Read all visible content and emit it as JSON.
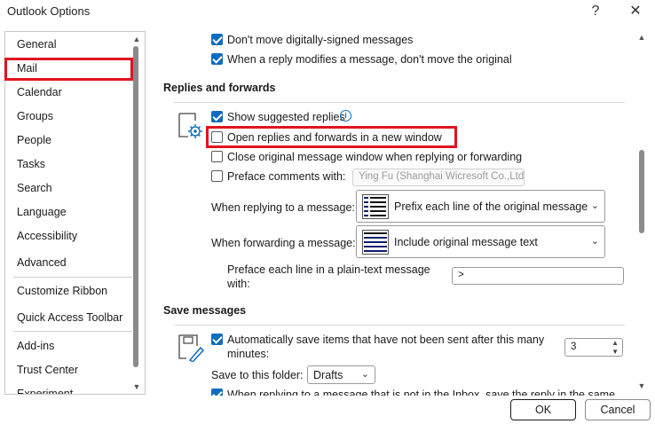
{
  "window": {
    "title": "Outlook Options",
    "help": "?",
    "close": "✕"
  },
  "sidebar": {
    "items": [
      {
        "label": "General"
      },
      {
        "label": "Mail"
      },
      {
        "label": "Calendar"
      },
      {
        "label": "Groups"
      },
      {
        "label": "People"
      },
      {
        "label": "Tasks"
      },
      {
        "label": "Search"
      },
      {
        "label": "Language"
      },
      {
        "label": "Accessibility"
      },
      {
        "label": "Advanced"
      },
      {
        "label": "Customize Ribbon"
      },
      {
        "label": "Quick Access Toolbar"
      },
      {
        "label": "Add-ins"
      },
      {
        "label": "Trust Center"
      },
      {
        "label": "Experiment"
      }
    ],
    "selected": "Mail"
  },
  "main": {
    "top_options": [
      {
        "label": "Don't move digitally-signed messages",
        "checked": true
      },
      {
        "label": "When a reply modifies a message, don't move the original",
        "checked": true
      }
    ],
    "replies": {
      "heading": "Replies and forwards",
      "show_suggested": {
        "label": "Show suggested replies",
        "checked": true
      },
      "open_new_window": {
        "label": "Open replies and forwards in a new window",
        "checked": false
      },
      "close_original": {
        "label": "Close original message window when replying or forwarding",
        "checked": false
      },
      "preface_comments": {
        "label": "Preface comments with:",
        "checked": false,
        "value": "Ying Fu (Shanghai Wicresoft Co.,Ltd"
      },
      "when_replying": {
        "label": "When replying to a message:",
        "value": "Prefix each line of the original message"
      },
      "when_forwarding": {
        "label": "When forwarding a message:",
        "value": "Include original message text"
      },
      "preface_line_label_1": "Preface each line in a plain-text message",
      "preface_line_label_2": "with:",
      "preface_line_value": ">"
    },
    "save": {
      "heading": "Save messages",
      "auto_save_1": "Automatically save items that have not been sent after this many",
      "auto_save_2": "minutes:",
      "auto_save_checked": true,
      "minutes": "3",
      "save_folder_label": "Save to this folder:",
      "save_folder_value": "Drafts",
      "when_replying_label": "When replying to a message that is not in the Inbox, save the reply in the same"
    }
  },
  "footer": {
    "ok": "OK",
    "cancel": "Cancel"
  },
  "colors": {
    "accent": "#0f6cbd",
    "highlight": "#e0141e"
  }
}
